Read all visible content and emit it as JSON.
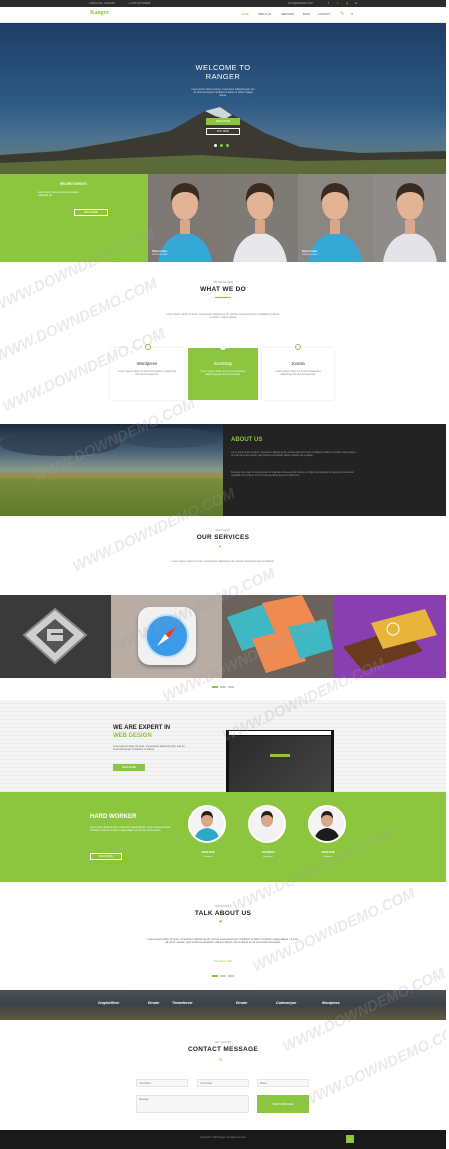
{
  "topbar": {
    "left": [
      "LANGUAGE - ENGLISH",
      "+ 1 555 ANYWHERE"
    ],
    "right": [
      "INFO@RANGER.COM"
    ],
    "social": [
      "f",
      "t",
      "g",
      "in"
    ]
  },
  "nav": {
    "brand": "Ranger",
    "items": [
      "HOME",
      "ABOUT US",
      "SERVICES",
      "BLOG",
      "CONTACT"
    ]
  },
  "hero": {
    "title1": "WELCOME TO",
    "title2": "RANGER",
    "text": "Lorem ipsum dolor sit amet, consectetur adipiscing elit, sed do eiusmod tempor incididunt ut labore et dolore magna aliqua.",
    "btn1": "READ MORE",
    "btn2": "BUY NOW"
  },
  "events": {
    "title": "RECENT EVENTS",
    "text": "Lorem ipsum dolor sit amet, consectetur adipiscing elit.",
    "btn": "READ MORE",
    "people": [
      {
        "name": "Robert Cutter",
        "role": "WEB DESIGNER"
      },
      {
        "name": "",
        "role": ""
      },
      {
        "name": "Robert Cutter",
        "role": "WEB DESIGNER"
      },
      {
        "name": "",
        "role": ""
      }
    ]
  },
  "whatwedo": {
    "kicker": "WE ARE RANGER",
    "title": "WHAT WE DO",
    "text": "Lorem ipsum dolor sit amet, consectetur adipiscing elit, sed do eiusmod tempor incididunt ut labore et dolore magna aliqua.",
    "cards": [
      {
        "title": "Wordpress",
        "text": "Lorem ipsum dolor sit amet consectetur adipiscing elit sed do eiusmod."
      },
      {
        "title": "Bootstrap",
        "text": "Lorem ipsum dolor sit amet consectetur adipiscing elit sed do eiusmod."
      },
      {
        "title": "Joomla",
        "text": "Lorem ipsum dolor sit amet consectetur adipiscing elit sed do eiusmod."
      }
    ]
  },
  "about": {
    "title": "ABOUT US",
    "p1": "Lorem ipsum dolor sit amet, consectetur adipiscing elit, sed do eiusmod tempor incididunt ut labore et dolore magna aliqua. Ut enim ad minim veniam, quis nostrud exercitation ullamco laboris nisi ut aliquip.",
    "p2": "Duis aute irure dolor in reprehenderit in voluptate velit esse cillum dolore eu fugiat nulla pariatur. Excepteur sint occaecat cupidatat non proident, sunt in culpa qui officia deserunt mollit anim."
  },
  "services": {
    "kicker": "WHAT WE DO",
    "title": "OUR SERVICES",
    "text": "Lorem ipsum dolor sit amet, consectetur adipiscing elit, sed do eiusmod tempor incididunt."
  },
  "expert": {
    "title1": "WE ARE EXPERT IN",
    "title2": "WEB DESIGN",
    "text": "Lorem ipsum dolor sit amet, consectetur adipiscing elit, sed do eiusmod tempor incididunt ut labore.",
    "btn": "READ MORE"
  },
  "hardworker": {
    "title": "HARD WORKER",
    "text": "Lorem ipsum dolor sit amet, consectetur adipiscing elit, sed do eiusmod tempor incididunt ut labore et dolore magna aliqua. Ut enim ad minim veniam.",
    "btn": "READ MORE",
    "team": [
      {
        "name": "JHON DOE",
        "role": "Designer"
      },
      {
        "name": "THUOMAS",
        "role": "Developer"
      },
      {
        "name": "JHON DOE",
        "role": "Manager"
      }
    ]
  },
  "talk": {
    "kicker": "TESTIMONIALS",
    "title": "TALK ABOUT US",
    "quote": "Lorem ipsum dolor sit amet, consectetur adipiscing elit, sed do eiusmod tempor incididunt ut labore et dolore magna aliqua. Ut enim ad minim veniam, quis nostrud exercitation ullamco laboris nisi ut aliquip ex ea commodo consequat.",
    "author": "Jhon Doe, CEO"
  },
  "clients": [
    "GraphicRiver",
    "Envato",
    "Themeforest",
    "Envato",
    "Codecanyon",
    "Wordpress"
  ],
  "contact": {
    "kicker": "GET IN TOUCH",
    "title": "CONTACT MESSAGE",
    "name_ph": "Your Name",
    "email_ph": "Your Email",
    "phone_ph": "Phone",
    "message_ph": "Message",
    "btn": "SEND MESSAGE"
  },
  "footer": {
    "text": "Copyright © 2015 Ranger. All rights reserved.",
    "up": "^"
  },
  "watermark": "WWW.DOWNDEMO.COM",
  "colors": {
    "accent": "#8cc63f",
    "dark": "#232323",
    "footer": "#1a1a1a"
  }
}
